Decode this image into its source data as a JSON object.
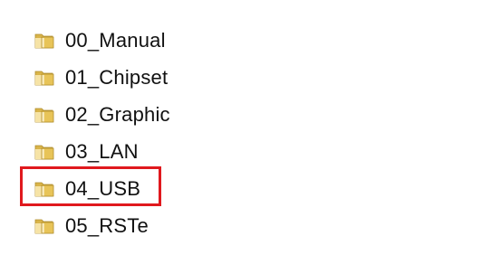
{
  "folder_list": {
    "items": [
      {
        "label": "00_Manual",
        "icon": "folder-icon"
      },
      {
        "label": "01_Chipset",
        "icon": "folder-icon"
      },
      {
        "label": "02_Graphic",
        "icon": "folder-icon"
      },
      {
        "label": "03_LAN",
        "icon": "folder-icon"
      },
      {
        "label": "04_USB",
        "icon": "folder-icon",
        "highlighted": true
      },
      {
        "label": "05_RSTe",
        "icon": "folder-icon"
      }
    ]
  },
  "colors": {
    "folder_body": "#e8c458",
    "folder_front": "#f4d98a",
    "folder_edge": "#b08d2e",
    "highlight": "#e0191e"
  }
}
